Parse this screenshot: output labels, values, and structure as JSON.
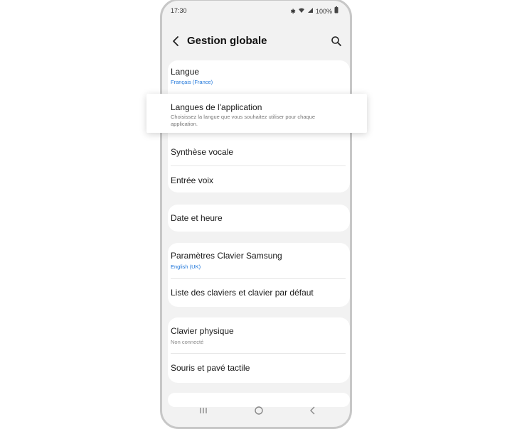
{
  "status_bar": {
    "time": "17:30",
    "battery": "100%",
    "icons": [
      "bluetooth-icon",
      "wifi-icon",
      "signal-icon",
      "battery-icon"
    ]
  },
  "header": {
    "title": "Gestion globale",
    "back_icon": "chevron-left-icon",
    "search_icon": "search-icon"
  },
  "items": {
    "langue": {
      "label": "Langue",
      "value": "Français (France)"
    },
    "app_languages": {
      "label": "Langues de l'application",
      "description": "Choisissez la langue que vous souhaitez utiliser pour chaque application."
    },
    "tts": {
      "label": "Synthèse vocale"
    },
    "voice_input": {
      "label": "Entrée voix"
    },
    "date_time": {
      "label": "Date et heure"
    },
    "samsung_keyboard": {
      "label": "Paramètres Clavier Samsung",
      "value": "English (UK)"
    },
    "keyboard_list": {
      "label": "Liste des claviers et clavier par défaut"
    },
    "physical_keyboard": {
      "label": "Clavier physique",
      "value": "Non connecté"
    },
    "mouse_touchpad": {
      "label": "Souris et pavé tactile"
    }
  },
  "nav_bar": {
    "buttons": [
      "recents-icon",
      "home-icon",
      "back-icon"
    ]
  },
  "colors": {
    "accent_value": "#1a73d9",
    "background": "#f2f2f2",
    "card": "#ffffff"
  }
}
